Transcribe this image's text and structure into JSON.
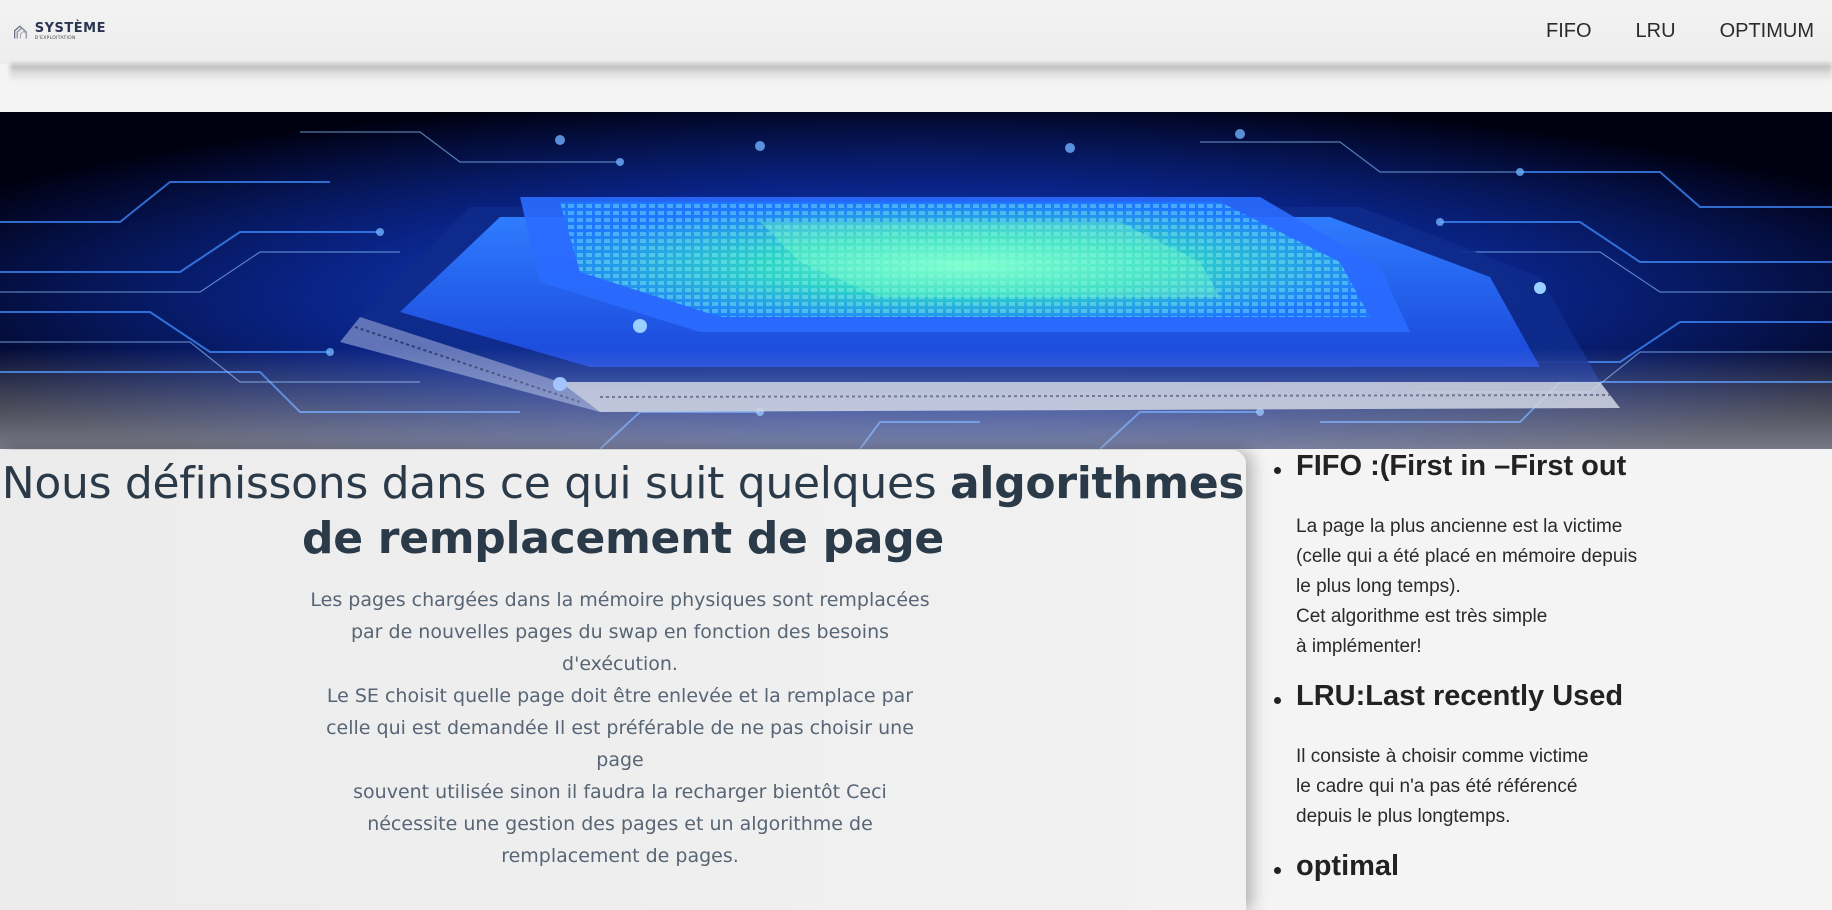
{
  "navbar": {
    "logo": {
      "title": "SYSTÈME",
      "subtitle": "D'EXPLOITATION"
    },
    "links": [
      {
        "label": "FIFO"
      },
      {
        "label": "LRU"
      },
      {
        "label": "OPTIMUM"
      }
    ]
  },
  "hero": {
    "icon": "circuit-board-cpu-image"
  },
  "main": {
    "heading_regular": "Nous définissons dans ce qui suit quelques ",
    "heading_bold": "algorithmes de remplacement de page",
    "intro_lines": [
      "Les pages chargées dans la mémoire physiques sont remplacées",
      "par de nouvelles pages du swap en fonction des besoins",
      "d'exécution.",
      "Le SE choisit quelle page doit être enlevée et la remplace par",
      "celle qui est demandée Il est préférable de ne pas choisir une",
      "page",
      "souvent utilisée sinon il faudra la recharger bientôt Ceci",
      "nécessite une gestion des pages et un algorithme de",
      "remplacement de pages."
    ]
  },
  "sidebar": {
    "algorithms": [
      {
        "title": "FIFO :(First in –First out",
        "lines": [
          "La page la plus ancienne est la victime",
          "(celle qui a été placé en mémoire depuis",
          "le plus long temps).",
          "Cet algorithme est très simple",
          "à implémenter!"
        ]
      },
      {
        "title": "LRU:Last recently Used",
        "lines": [
          "Il consiste à choisir comme victime",
          "le cadre qui n'a pas été référencé",
          "depuis le plus longtemps."
        ]
      },
      {
        "title": "optimal",
        "lines": []
      }
    ]
  },
  "colors": {
    "heading": "#2b3a48",
    "intro_text": "#586575",
    "hero_glow": "#1e5bff",
    "hero_chip": "#3fe0c8"
  }
}
